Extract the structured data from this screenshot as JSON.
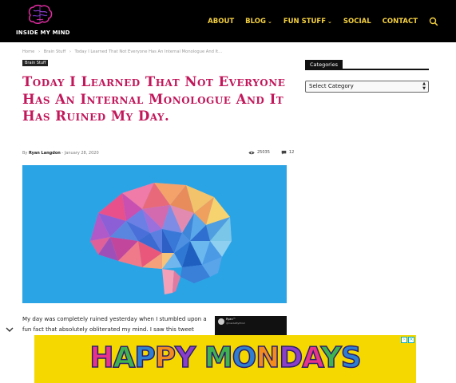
{
  "site": {
    "logo_text": "INSIDE MY MIND"
  },
  "nav": {
    "items": [
      {
        "label": "ABOUT",
        "has_dropdown": false
      },
      {
        "label": "BLOG",
        "has_dropdown": true
      },
      {
        "label": "FUN STUFF",
        "has_dropdown": true
      },
      {
        "label": "SOCIAL",
        "has_dropdown": false
      },
      {
        "label": "CONTACT",
        "has_dropdown": false
      }
    ],
    "search_icon": "search-icon",
    "text_color": "#f4d03f"
  },
  "breadcrumb": {
    "items": [
      "Home",
      "Brain Stuff",
      "Today I Learned That Not Everyone Has An Internal Monologue And It..."
    ],
    "separator": "›"
  },
  "article": {
    "category": "Brain Stuff",
    "title": "Today I Learned That Not Everyone Has An Internal Monologue And It Has Ruined My Day.",
    "by_label": "By",
    "author": "Ryan Langdon",
    "date_sep": "-",
    "date": "January 28, 2020",
    "views": "25035",
    "comments": "12",
    "title_color": "#c2185b",
    "hero_bg": "#2ba4e5",
    "body": "My day was completely ruined yesterday when I stumbled upon a fun fact that absolutely obliterated my mind. I saw this tweet",
    "tweet_name": "Ryan™",
    "tweet_handle": "@InsideMyMind"
  },
  "sidebar": {
    "title": "Categories",
    "select_value": "Select Category"
  },
  "ad": {
    "text": "HAPPY MONDAYS",
    "bg": "#f5d800"
  }
}
